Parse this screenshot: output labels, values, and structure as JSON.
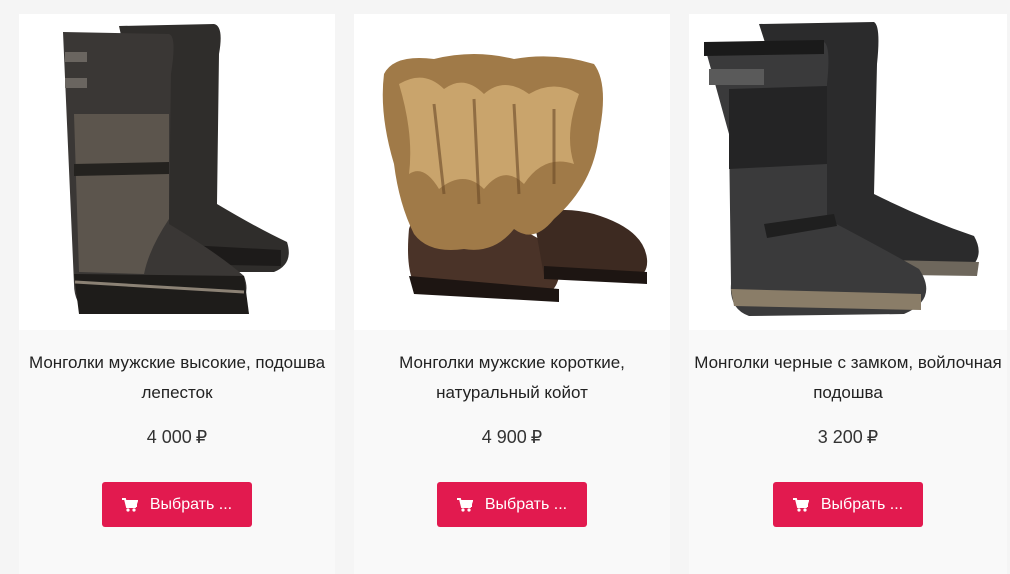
{
  "products": [
    {
      "title": "Монголки мужские высокие, подошва лепесток",
      "price": "4 000",
      "currency": "₽",
      "button_label": "Выбрать ..."
    },
    {
      "title": "Монголки мужские короткие, натуральный койот",
      "price": "4 900",
      "currency": "₽",
      "button_label": "Выбрать ..."
    },
    {
      "title": "Монголки черные с замком, войлочная подошва",
      "price": "3 200",
      "currency": "₽",
      "button_label": "Выбрать ..."
    }
  ],
  "icons": {
    "cart": "shopping-cart-icon"
  },
  "colors": {
    "button": "#e21a4f",
    "card": "#f9f9f9",
    "image_bg": "#ffffff"
  }
}
